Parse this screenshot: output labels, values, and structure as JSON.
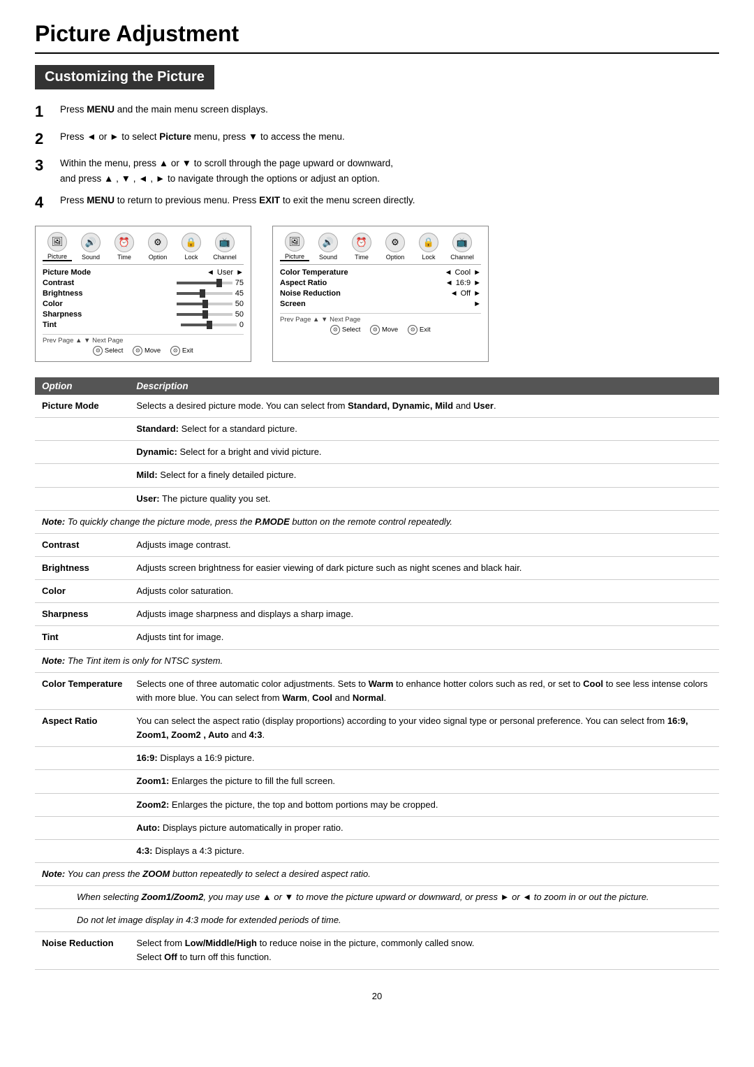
{
  "page": {
    "title": "Picture Adjustment",
    "section_heading": "Customizing the Picture",
    "page_number": "20"
  },
  "steps": [
    {
      "num": "1",
      "text": "Press <b>MENU</b> and the main menu screen displays."
    },
    {
      "num": "2",
      "text": "Press ◄ or ► to select <b>Picture</b> menu,  press ▼  to access the menu."
    },
    {
      "num": "3",
      "text": "Within the menu, press ▲ or ▼ to scroll through the page upward or downward, and press ▲ , ▼ , ◄ , ► to navigate through the options or adjust an option."
    },
    {
      "num": "4",
      "text": "Press <b>MENU</b> to return to previous menu. Press <b>EXIT</b> to exit the menu screen directly."
    }
  ],
  "menu_left": {
    "icons": [
      {
        "label": "Picture",
        "symbol": "🖼",
        "active": true
      },
      {
        "label": "Sound",
        "symbol": "🔊",
        "active": false
      },
      {
        "label": "Time",
        "symbol": "⏰",
        "active": false
      },
      {
        "label": "Option",
        "symbol": "⚙",
        "active": false
      },
      {
        "label": "Lock",
        "symbol": "🔒",
        "active": false
      },
      {
        "label": "Channel",
        "symbol": "📺",
        "active": false
      }
    ],
    "rows": [
      {
        "label": "Picture Mode",
        "left_arrow": true,
        "value": "User",
        "right_arrow": true,
        "slider": false,
        "num": null
      },
      {
        "label": "Contrast",
        "left_arrow": false,
        "value": "",
        "right_arrow": false,
        "slider": true,
        "slider_pct": 75,
        "num": "75"
      },
      {
        "label": "Brightness",
        "left_arrow": false,
        "value": "",
        "right_arrow": false,
        "slider": true,
        "slider_pct": 45,
        "num": "45"
      },
      {
        "label": "Color",
        "left_arrow": false,
        "value": "",
        "right_arrow": false,
        "slider": true,
        "slider_pct": 50,
        "num": "50"
      },
      {
        "label": "Sharpness",
        "left_arrow": false,
        "value": "",
        "right_arrow": false,
        "slider": true,
        "slider_pct": 50,
        "num": "50"
      },
      {
        "label": "Tint",
        "left_arrow": false,
        "value": "",
        "right_arrow": false,
        "slider": true,
        "slider_pct": 50,
        "num": "0"
      }
    ],
    "footer_page": "Prev Page ▲  ▼ Next Page",
    "footer_btns": [
      {
        "icon": "⊙",
        "label": "Select"
      },
      {
        "icon": "⊙",
        "label": "Move"
      },
      {
        "icon": "⊙",
        "label": "Exit"
      }
    ]
  },
  "menu_right": {
    "icons": [
      {
        "label": "Picture",
        "symbol": "🖼",
        "active": true
      },
      {
        "label": "Sound",
        "symbol": "🔊",
        "active": false
      },
      {
        "label": "Time",
        "symbol": "⏰",
        "active": false
      },
      {
        "label": "Option",
        "symbol": "⚙",
        "active": false
      },
      {
        "label": "Lock",
        "symbol": "🔒",
        "active": false
      },
      {
        "label": "Channel",
        "symbol": "📺",
        "active": false
      }
    ],
    "rows": [
      {
        "label": "Color Temperature",
        "left_arrow": true,
        "value": "Cool",
        "right_arrow": true,
        "slider": false,
        "num": null
      },
      {
        "label": "Aspect Ratio",
        "left_arrow": true,
        "value": "16:9",
        "right_arrow": true,
        "slider": false,
        "num": null
      },
      {
        "label": "Noise Reduction",
        "left_arrow": true,
        "value": "Off",
        "right_arrow": true,
        "slider": false,
        "num": null
      },
      {
        "label": "Screen",
        "left_arrow": false,
        "value": "",
        "right_arrow": true,
        "slider": false,
        "num": null
      }
    ],
    "footer_page": "Prev Page ▲  ▼ Next Page",
    "footer_btns": [
      {
        "icon": "⊙",
        "label": "Select"
      },
      {
        "icon": "⊙",
        "label": "Move"
      },
      {
        "icon": "⊙",
        "label": "Exit"
      }
    ]
  },
  "table": {
    "col1": "Option",
    "col2": "Description",
    "rows": [
      {
        "type": "main",
        "option": "Picture Mode",
        "description": "Selects a desired picture mode. You can select from Standard, Dynamic, Mild and User.",
        "bold_parts": [
          "Standard, Dynamic, Mild",
          "User"
        ]
      },
      {
        "type": "sub",
        "option": "",
        "description": "Standard: Select for a standard picture.",
        "bold_start": "Standard:"
      },
      {
        "type": "sub",
        "option": "",
        "description": "Dynamic: Select for a bright and vivid picture.",
        "bold_start": "Dynamic:"
      },
      {
        "type": "sub",
        "option": "",
        "description": "Mild: Select for a finely detailed picture.",
        "bold_start": "Mild:"
      },
      {
        "type": "sub",
        "option": "",
        "description": "User: The picture quality you set.",
        "bold_start": "User:"
      },
      {
        "type": "note",
        "option": "",
        "description": "Note: To quickly change the picture mode, press the P.MODE button on the remote control repeatedly.",
        "note_label": "Note:",
        "italic_rest": " To quickly change the picture mode, press the P.MODE button on the remote control repeatedly."
      },
      {
        "type": "main",
        "option": "Contrast",
        "description": "Adjusts image contrast."
      },
      {
        "type": "main",
        "option": "Brightness",
        "description": "Adjusts screen brightness for easier viewing of dark picture such as night scenes and black hair."
      },
      {
        "type": "main",
        "option": "Color",
        "description": "Adjusts color saturation."
      },
      {
        "type": "main",
        "option": "Sharpness",
        "description": "Adjusts image sharpness and displays a sharp image."
      },
      {
        "type": "main",
        "option": "Tint",
        "description": "Adjusts tint for image."
      },
      {
        "type": "note",
        "option": "",
        "description": "Note: The Tint item is only for NTSC system.",
        "note_label": "Note:",
        "italic_rest": " The Tint item is only for NTSC system."
      },
      {
        "type": "main",
        "option": "Color Temperature",
        "description": "Selects one of three automatic color adjustments.  Sets to Warm to enhance hotter colors such as red,  or set to Cool to see less intense colors with more blue.  You can select from Warm, Cool and Normal.",
        "bold_parts": [
          "Warm",
          "Cool",
          "Warm",
          "Cool",
          "Normal"
        ]
      },
      {
        "type": "main",
        "option": "Aspect Ratio",
        "description": "You can select the aspect ratio (display proportions) according to your video signal type or personal preference. You can select from 16:9, Zoom1, Zoom2 , Auto and 4:3.",
        "bold_parts": [
          "16:9, Zoom1, Zoom2 , Auto",
          "4:3"
        ]
      },
      {
        "type": "sub",
        "option": "",
        "description": "16:9: Displays a 16:9 picture.",
        "bold_start": "16:9:"
      },
      {
        "type": "sub",
        "option": "",
        "description": "Zoom1: Enlarges the picture to fill the full screen.",
        "bold_start": "Zoom1:"
      },
      {
        "type": "sub",
        "option": "",
        "description": "Zoom2: Enlarges the picture, the top and bottom portions may be cropped.",
        "bold_start": "Zoom2:"
      },
      {
        "type": "sub",
        "option": "",
        "description": "Auto: Displays picture automatically in proper ratio.",
        "bold_start": "Auto:"
      },
      {
        "type": "sub",
        "option": "",
        "description": "4:3: Displays a 4:3 picture.",
        "bold_start": "4:3:"
      },
      {
        "type": "note",
        "option": "",
        "description": "Note: You can press the ZOOM button repeatedly to select a desired aspect ratio.",
        "note_label": "Note:",
        "italic_rest": " You can press the ZOOM button repeatedly to select a desired aspect ratio."
      },
      {
        "type": "note2",
        "option": "",
        "description": "When selecting Zoom1/Zoom2, you may use ▲ or ▼ to move the picture upward or downward, or press ► or ◄ to zoom in or out the picture.",
        "italic": true
      },
      {
        "type": "note2",
        "option": "",
        "description": "Do not let image display in 4:3 mode for extended periods of time.",
        "italic": true
      },
      {
        "type": "main",
        "option": "Noise Reduction",
        "description": "Select from Low/Middle/High to reduce noise in the picture, commonly called snow. Select Off to turn off this function.",
        "bold_parts": [
          "Low/Middle/High",
          "Off"
        ]
      }
    ]
  }
}
